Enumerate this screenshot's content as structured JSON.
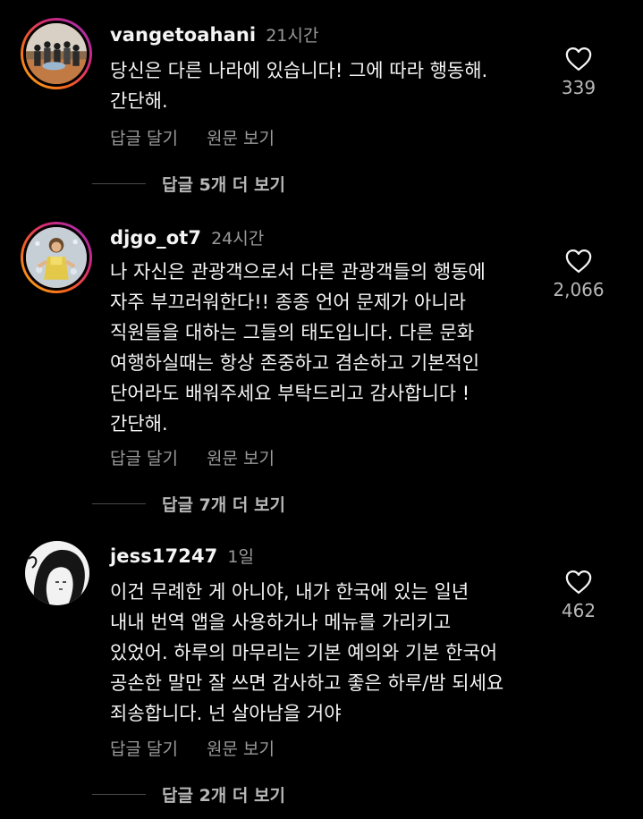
{
  "comments": [
    {
      "username": "vangetoahani",
      "time": "21시간",
      "text": "당신은 다른 나라에 있습니다! 그에 따라 행동해.\n간단해.",
      "likes": "339",
      "reply_label": "답글 달기",
      "translate_label": "원문 보기",
      "more_replies": "답글 5개 더 보기"
    },
    {
      "username": "djgo_ot7",
      "time": "24시간",
      "text": "나 자신은 관광객으로서 다른 관광객들의 행동에\n자주 부끄러워한다!! 종종 언어 문제가 아니라\n직원들을 대하는 그들의 태도입니다. 다른 문화\n여행하실때는 항상 존중하고 겸손하고 기본적인\n단어라도 배워주세요 부탁드리고 감사합니다 !\n간단해.",
      "likes": "2,066",
      "reply_label": "답글 달기",
      "translate_label": "원문 보기",
      "more_replies": "답글 7개 더 보기"
    },
    {
      "username": "jess17247",
      "time": "1일",
      "text": "이건 무례한 게 아니야, 내가 한국에 있는 일년\n내내 번역 앱을 사용하거나 메뉴를 가리키고\n있었어. 하루의 마무리는 기본 예의와 기본 한국어\n공손한 말만 잘 쓰면 감사하고 좋은 하루/밤 되세요\n죄송합니다. 넌 살아남을 거야",
      "likes": "462",
      "reply_label": "답글 달기",
      "translate_label": "원문 보기",
      "more_replies": "답글 2개 더 보기"
    }
  ],
  "colors": {
    "background": "#000000",
    "text_primary": "#f5f5f5",
    "text_secondary": "#9a9a9a",
    "story_ring": [
      "#f9b21a",
      "#d62976",
      "#962fbf"
    ]
  },
  "icons": {
    "like": "heart-outline-icon"
  }
}
